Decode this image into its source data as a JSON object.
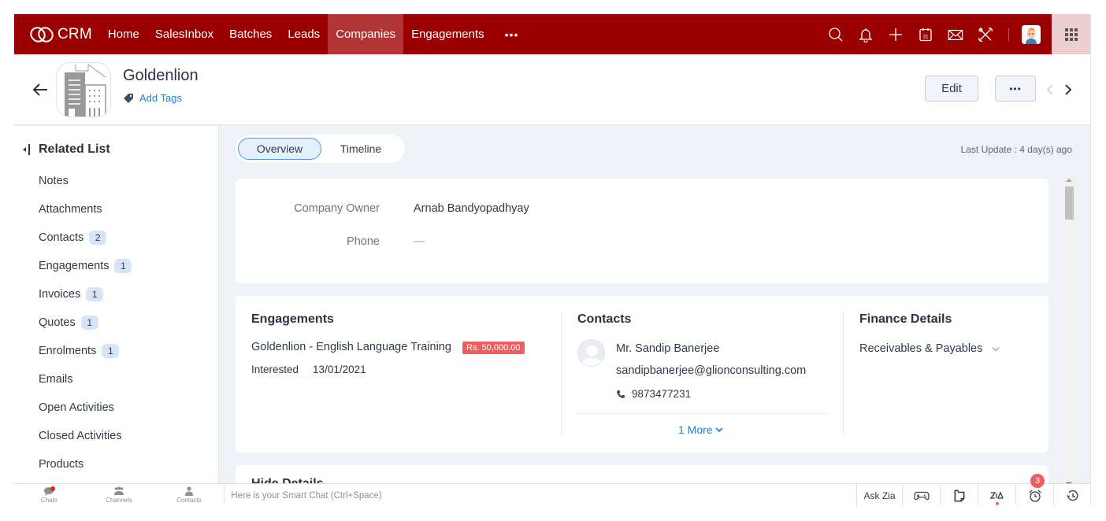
{
  "topnav": {
    "brand": "CRM",
    "tabs": [
      {
        "label": "Home",
        "active": false
      },
      {
        "label": "SalesInbox",
        "active": false
      },
      {
        "label": "Batches",
        "active": false
      },
      {
        "label": "Leads",
        "active": false
      },
      {
        "label": "Companies",
        "active": true
      },
      {
        "label": "Engagements",
        "active": false
      }
    ],
    "more_label": "•••",
    "icons": [
      "search-icon",
      "bell-icon",
      "plus-icon",
      "calendar-icon",
      "mail-icon",
      "tools-icon",
      "user-avatar",
      "apps-grid-icon"
    ],
    "calendar_day": "31"
  },
  "record": {
    "title": "Goldenlion",
    "add_tags_label": "Add Tags",
    "edit_label": "Edit",
    "more_label": "•••"
  },
  "related_list": {
    "title": "Related List",
    "items": [
      {
        "label": "Notes",
        "count": null
      },
      {
        "label": "Attachments",
        "count": null
      },
      {
        "label": "Contacts",
        "count": "2"
      },
      {
        "label": "Engagements",
        "count": "1"
      },
      {
        "label": "Invoices",
        "count": "1"
      },
      {
        "label": "Quotes",
        "count": "1"
      },
      {
        "label": "Enrolments",
        "count": "1"
      },
      {
        "label": "Emails",
        "count": null
      },
      {
        "label": "Open Activities",
        "count": null
      },
      {
        "label": "Closed Activities",
        "count": null
      },
      {
        "label": "Products",
        "count": null
      }
    ]
  },
  "main": {
    "tabs": [
      {
        "label": "Overview",
        "active": true
      },
      {
        "label": "Timeline",
        "active": false
      }
    ],
    "last_update": "Last Update : 4 day(s) ago",
    "fields": [
      {
        "label": "Company Owner",
        "value": "Arnab Bandyopadhyay"
      },
      {
        "label": "Phone",
        "value": "—"
      }
    ],
    "engagements": {
      "title": "Engagements",
      "name": "Goldenlion - English Language Training",
      "amount": "Rs. 50,000.00",
      "status": "Interested",
      "date": "13/01/2021"
    },
    "contacts": {
      "title": "Contacts",
      "name": "Mr. Sandip Banerjee",
      "email": "sandipbanerjee@glionconsulting.com",
      "phone": "9873477231",
      "more_label": "1 More"
    },
    "finance": {
      "title": "Finance Details",
      "item": "Receivables & Payables"
    },
    "hide_details_label": "Hide Details"
  },
  "bottombar": {
    "tabs": [
      {
        "label": "Chats"
      },
      {
        "label": "Channels"
      },
      {
        "label": "Contacts"
      }
    ],
    "smart_chat_placeholder": "Here is your Smart Chat (Ctrl+Space)",
    "ask_zia": "Ask Zia",
    "reminder_count": "3"
  }
}
